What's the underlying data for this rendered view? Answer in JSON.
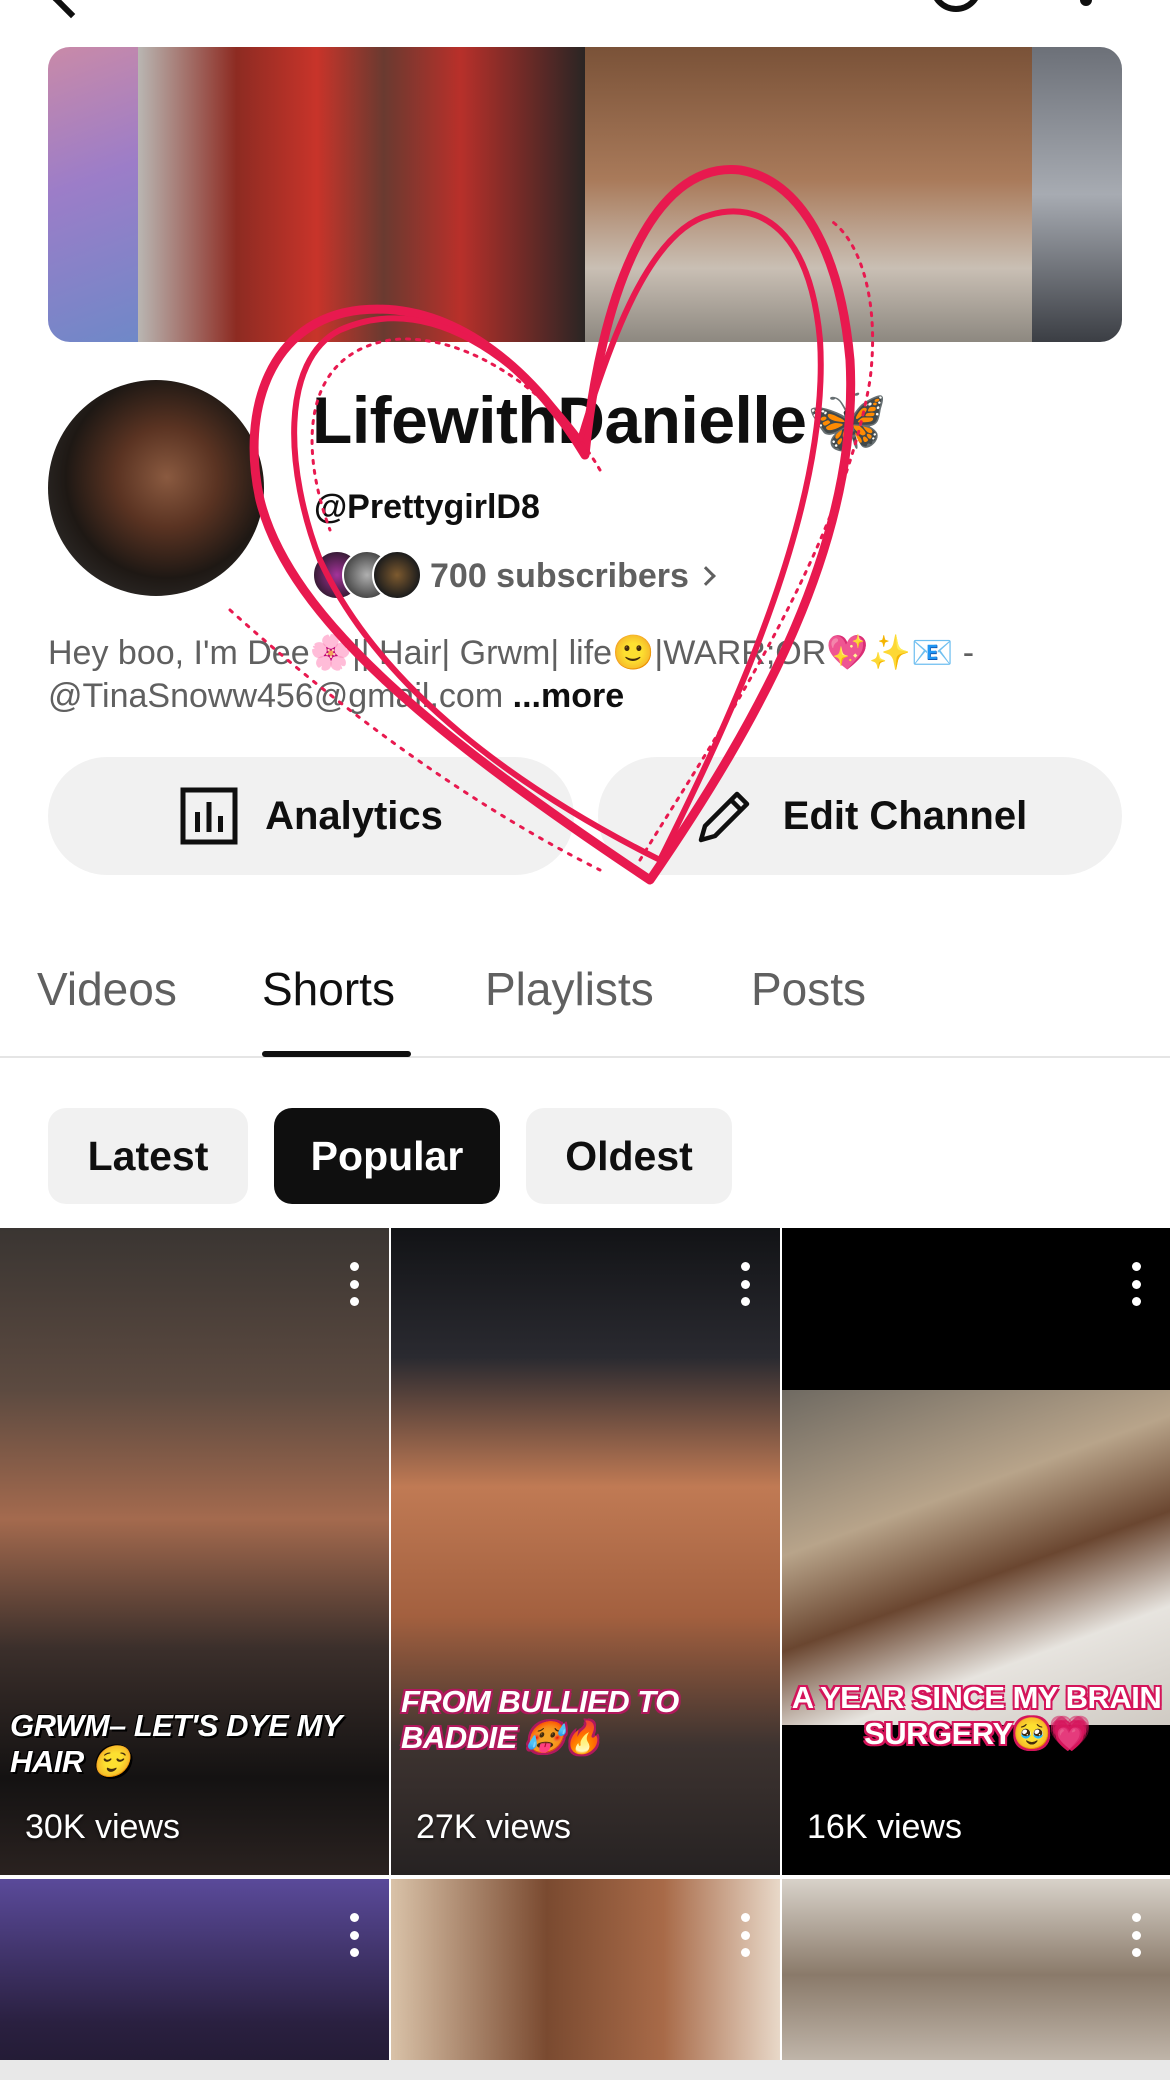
{
  "header": {
    "back_icon": "back-arrow-icon",
    "search_icon": "search-icon",
    "menu_icon": "more-vert-icon"
  },
  "channel": {
    "name": "LifewithDanielle🦋",
    "handle": "@PrettygirlD8",
    "subscribers": "700 subscribers",
    "bio_text": "Hey boo, I'm Dee🌸|| Hair| Grwm| life🙂|WARR;OR💖✨📧 - @TinaSnoww456@gmail.com ",
    "bio_more": "...more"
  },
  "actions": {
    "analytics_label": "Analytics",
    "edit_label": "Edit Channel"
  },
  "tabs": [
    "Videos",
    "Shorts",
    "Playlists",
    "Posts"
  ],
  "active_tab": "Shorts",
  "sort_chips": [
    "Latest",
    "Popular",
    "Oldest"
  ],
  "active_chip": "Popular",
  "shorts": [
    {
      "overlay": "GRWM– LET'S DYE MY HAIR 😌",
      "views": "30K views"
    },
    {
      "overlay": "FROM BULLIED TO BADDIE 🥵🔥",
      "views": "27K views"
    },
    {
      "overlay": "A YEAR SINCE MY BRAIN SURGERY🥹💗",
      "views": "16K views"
    },
    {
      "overlay": "",
      "views": ""
    },
    {
      "overlay": "",
      "views": ""
    },
    {
      "overlay": "",
      "views": ""
    }
  ],
  "colors": {
    "text_primary": "#0f0f0f",
    "text_secondary": "#606060",
    "chip_bg": "#f1f1f1",
    "active_chip_bg": "#0f0f0f",
    "doodle": "#e8194f"
  }
}
